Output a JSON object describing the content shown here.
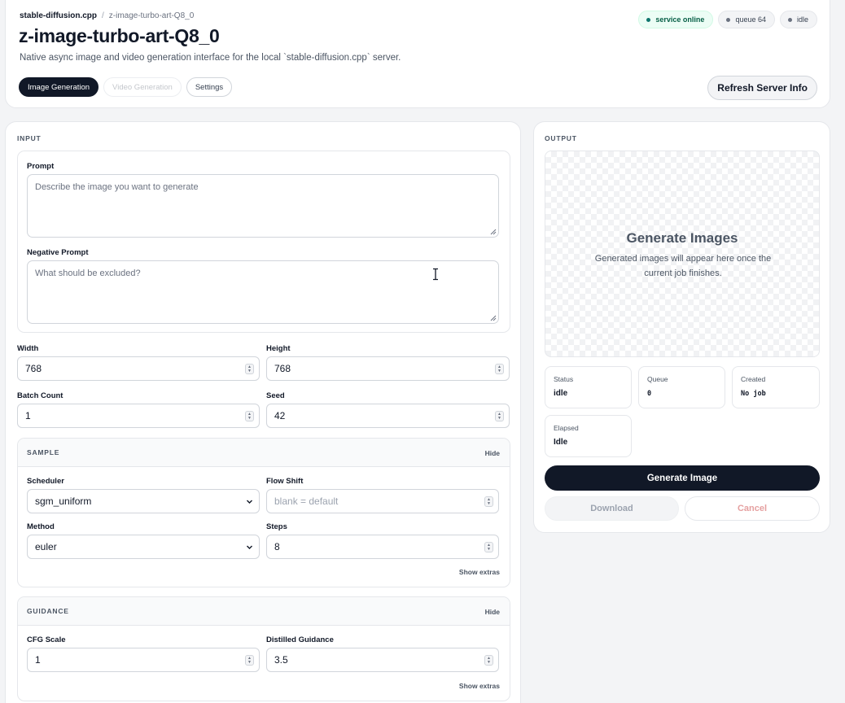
{
  "header": {
    "breadcrumb_root": "stable-diffusion.cpp",
    "breadcrumb_sep": "/",
    "breadcrumb_current": "z-image-turbo-art-Q8_0",
    "title": "z-image-turbo-art-Q8_0",
    "subtitle": "Native async image and video generation interface for the local `stable-diffusion.cpp` server.",
    "badges": [
      "service online",
      "queue 64",
      "idle"
    ],
    "tabs": [
      "Image Generation",
      "Video Generation",
      "Settings"
    ],
    "refresh_label": "Refresh Server Info"
  },
  "input": {
    "section_label": "INPUT",
    "prompt_label": "Prompt",
    "prompt_placeholder": "Describe the image you want to generate",
    "negative_label": "Negative Prompt",
    "negative_placeholder": "What should be excluded?",
    "width_label": "Width",
    "width_value": "768",
    "height_label": "Height",
    "height_value": "768",
    "batch_label": "Batch Count",
    "batch_value": "1",
    "seed_label": "Seed",
    "seed_value": "42",
    "sample": {
      "label": "SAMPLE",
      "hide": "Hide",
      "scheduler_label": "Scheduler",
      "scheduler_value": "sgm_uniform",
      "flow_shift_label": "Flow Shift",
      "flow_shift_placeholder": "blank = default",
      "method_label": "Method",
      "method_value": "euler",
      "steps_label": "Steps",
      "steps_value": "8",
      "extras": "Show extras"
    },
    "guidance": {
      "label": "GUIDANCE",
      "hide": "Hide",
      "cfg_label": "CFG Scale",
      "cfg_value": "1",
      "distilled_label": "Distilled Guidance",
      "distilled_value": "3.5",
      "extras": "Show extras"
    }
  },
  "output": {
    "section_label": "OUTPUT",
    "preview_title": "Generate Images",
    "preview_text": "Generated images will appear here once the current job finishes.",
    "stats": {
      "status_label": "Status",
      "status_value": "idle",
      "queue_label": "Queue",
      "queue_value": "0",
      "created_label": "Created",
      "created_value": "No job",
      "elapsed_label": "Elapsed",
      "elapsed_value": "Idle"
    },
    "generate_label": "Generate Image",
    "download_label": "Download",
    "cancel_label": "Cancel"
  },
  "colors": {
    "primary": "#111827",
    "online": "#0f766e",
    "cancel_text": "#e5a0a0"
  }
}
